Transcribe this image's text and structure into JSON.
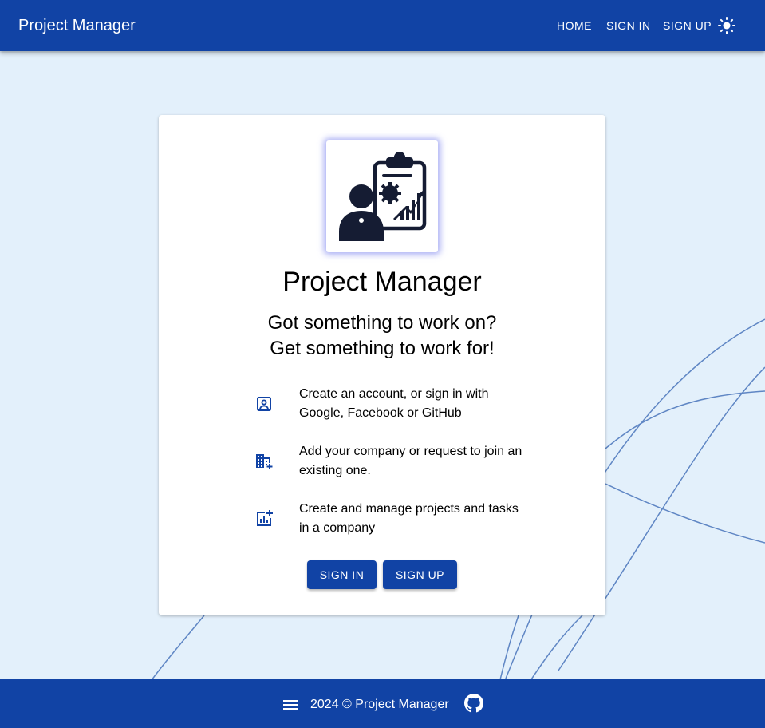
{
  "appbar": {
    "title": "Project Manager",
    "nav": {
      "home": "HOME",
      "sign_in": "SIGN IN",
      "sign_up": "SIGN UP"
    },
    "theme_icon": "sun-icon"
  },
  "card": {
    "logo_icon": "project-manager-logo-icon",
    "title": "Project Manager",
    "tagline_1": "Got something to work on?",
    "tagline_2": "Get something to work for!",
    "features": [
      {
        "icon": "account-box-icon",
        "text": "Create an account, or sign in with Google, Facebook or GitHub"
      },
      {
        "icon": "add-business-icon",
        "text": "Add your company or request to join an existing one."
      },
      {
        "icon": "add-chart-icon",
        "text": "Create and manage projects and tasks in a company"
      }
    ],
    "buttons": {
      "sign_in": "SIGN IN",
      "sign_up": "SIGN UP"
    }
  },
  "footer": {
    "text": "2024 © Project Manager",
    "menu_icon": "menu-icon",
    "github_icon": "github-icon"
  },
  "colors": {
    "primary": "#1143a5",
    "background": "#e3f0fb",
    "surface": "#ffffff",
    "decor_lines": "#5f86c4"
  }
}
